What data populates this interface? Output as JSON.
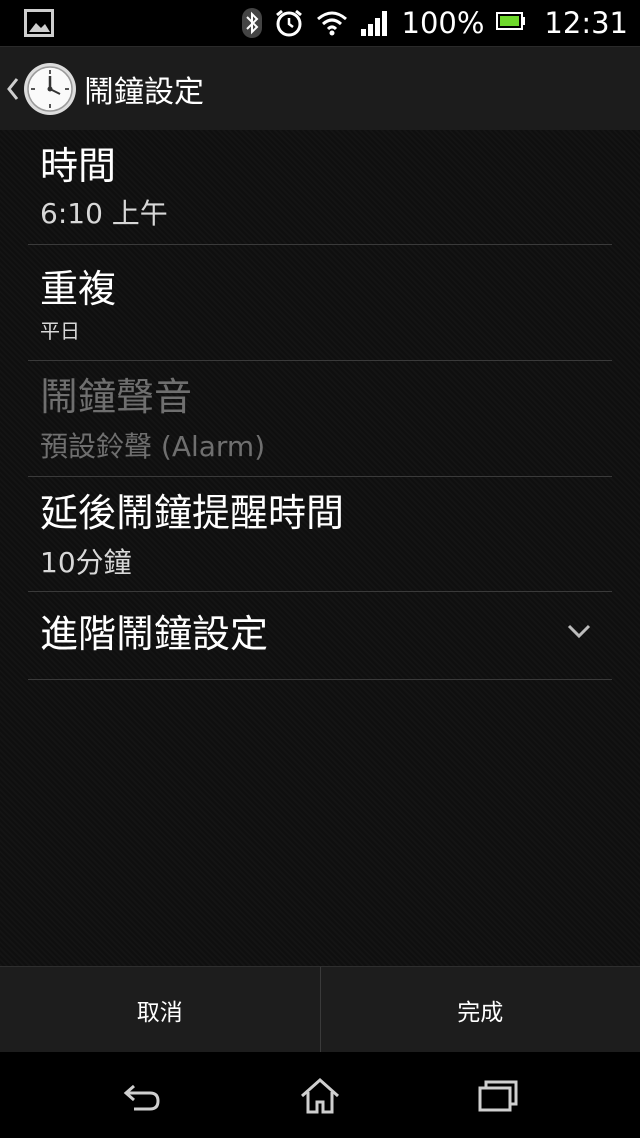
{
  "status_bar": {
    "battery_text": "100%",
    "time": "12:31",
    "icons": [
      "image-icon",
      "bluetooth-icon",
      "alarm-icon",
      "wifi-icon",
      "signal-icon",
      "battery-icon"
    ]
  },
  "action_bar": {
    "title": "鬧鐘設定"
  },
  "settings": {
    "time": {
      "label": "時間",
      "value": "6:10 上午"
    },
    "repeat": {
      "label": "重複",
      "value": "平日"
    },
    "alarm_sound": {
      "label": "鬧鐘聲音",
      "value": "預設鈴聲 (Alarm)"
    },
    "snooze": {
      "label": "延後鬧鐘提醒時間",
      "value": "10分鐘"
    },
    "advanced": {
      "label": "進階鬧鐘設定"
    }
  },
  "buttons": {
    "cancel": "取消",
    "done": "完成"
  },
  "colors": {
    "battery_green": "#6fd92c",
    "disabled_text": "#6f6f6f"
  }
}
